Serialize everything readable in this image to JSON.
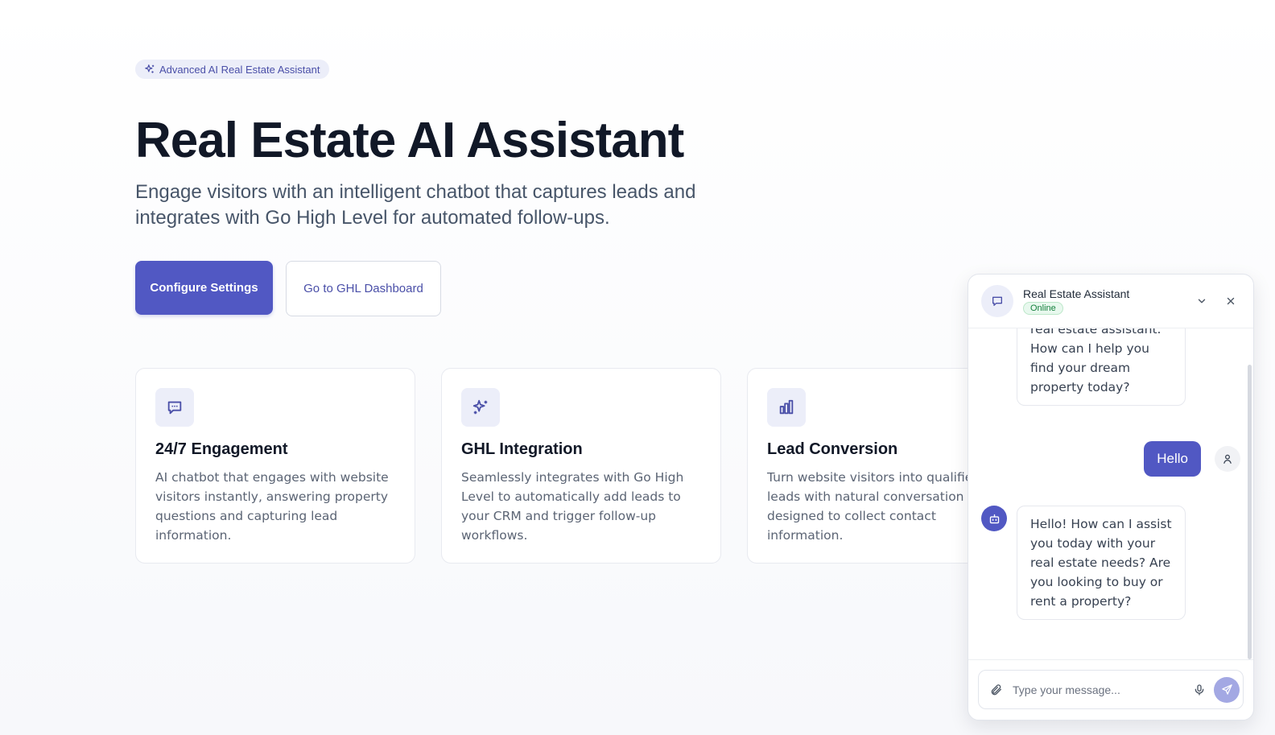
{
  "hero": {
    "badge": "Advanced AI Real Estate Assistant",
    "title": "Real Estate AI Assistant",
    "subtitle": "Engage visitors with an intelligent chatbot that captures leads and integrates with Go High Level for automated follow-ups."
  },
  "buttons": {
    "configure": "Configure Settings",
    "dashboard": "Go to GHL Dashboard"
  },
  "cards": [
    {
      "icon": "message-square-icon",
      "title": "24/7 Engagement",
      "desc": "AI chatbot that engages with website visitors instantly, answering property questions and capturing lead information."
    },
    {
      "icon": "sparkles-icon",
      "title": "GHL Integration",
      "desc": "Seamlessly integrates with Go High Level to automatically add leads to your CRM and trigger follow-up workflows."
    },
    {
      "icon": "bar-chart-icon",
      "title": "Lead Conversion",
      "desc": "Turn website visitors into qualified leads with natural conversation flows designed to collect contact information."
    }
  ],
  "chat": {
    "name": "Real Estate Assistant",
    "status": "Online",
    "messages": [
      {
        "from": "bot",
        "text": "real estate assistant. How can I help you find your dream property today?"
      },
      {
        "from": "user",
        "text": "Hello"
      },
      {
        "from": "bot",
        "text": "Hello! How can I assist you today with your real estate needs? Are you looking to buy or rent a property?"
      }
    ],
    "placeholder": "Type your message..."
  },
  "colors": {
    "accent": "#5158c3",
    "accent_light": "#eceef9",
    "send_disabled": "#a3a8e3",
    "online": "#15803d"
  }
}
